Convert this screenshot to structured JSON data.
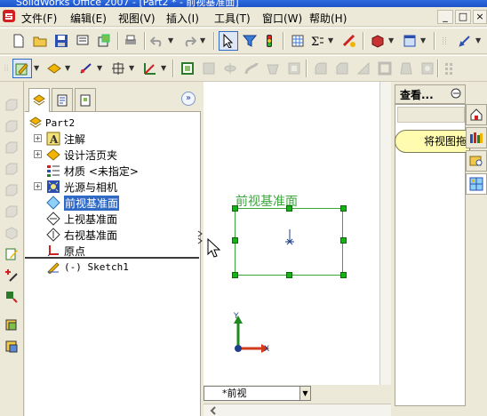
{
  "titlebar": {
    "title": "SolidWorks Office 2007 - [Part2 * - 前视基准面]"
  },
  "menu": {
    "items": [
      "文件(F)",
      "编辑(E)",
      "视图(V)",
      "插入(I)",
      "工具(T)",
      "窗口(W)",
      "帮助(H)"
    ]
  },
  "window_controls": {
    "minimize": "_",
    "restore": "□",
    "close": "×"
  },
  "feature_manager": {
    "part_name": "Part2",
    "items": [
      {
        "label": "注解"
      },
      {
        "label": "设计活页夹"
      },
      {
        "label": "材质 <未指定>"
      },
      {
        "label": "光源与相机"
      },
      {
        "label": "前视基准面"
      },
      {
        "label": "上视基准面"
      },
      {
        "label": "右视基准面"
      },
      {
        "label": "原点"
      },
      {
        "label": "(-) Sketch1"
      }
    ],
    "selected_item": "前视基准面"
  },
  "graphics": {
    "plane_label": "前视基准面",
    "axis_y": "Y",
    "axis_x": "X",
    "view_tab": "*前视"
  },
  "task_pane": {
    "header": "查看...",
    "view_palette_button": "将视图拖"
  },
  "colors": {
    "accent": "#316ac5",
    "plane": "#38a838",
    "title": "#1d52c8",
    "task_pill": "#fffcb0"
  }
}
